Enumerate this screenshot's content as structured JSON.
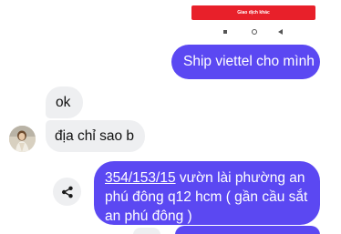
{
  "preview": {
    "button_label": "Giao dịch khác"
  },
  "messages": [
    {
      "direction": "outgoing",
      "text": "Ship viettel cho mình"
    },
    {
      "direction": "incoming",
      "text": "ok"
    },
    {
      "direction": "incoming",
      "text": "địa chỉ sao b"
    },
    {
      "direction": "outgoing",
      "link_text": "354/153/15",
      "text_line1_rest": " vườn lài phường an",
      "text_line2": "phú đông q12 hcm ( gần cầu sắt",
      "text_line3": "an phú đông )"
    }
  ],
  "icons": {
    "share": "share-icon",
    "avatar": "avatar"
  },
  "colors": {
    "outgoing_bubble": "#5b48f2",
    "incoming_bubble": "#eeeff1",
    "preview_button": "#e8202a"
  }
}
